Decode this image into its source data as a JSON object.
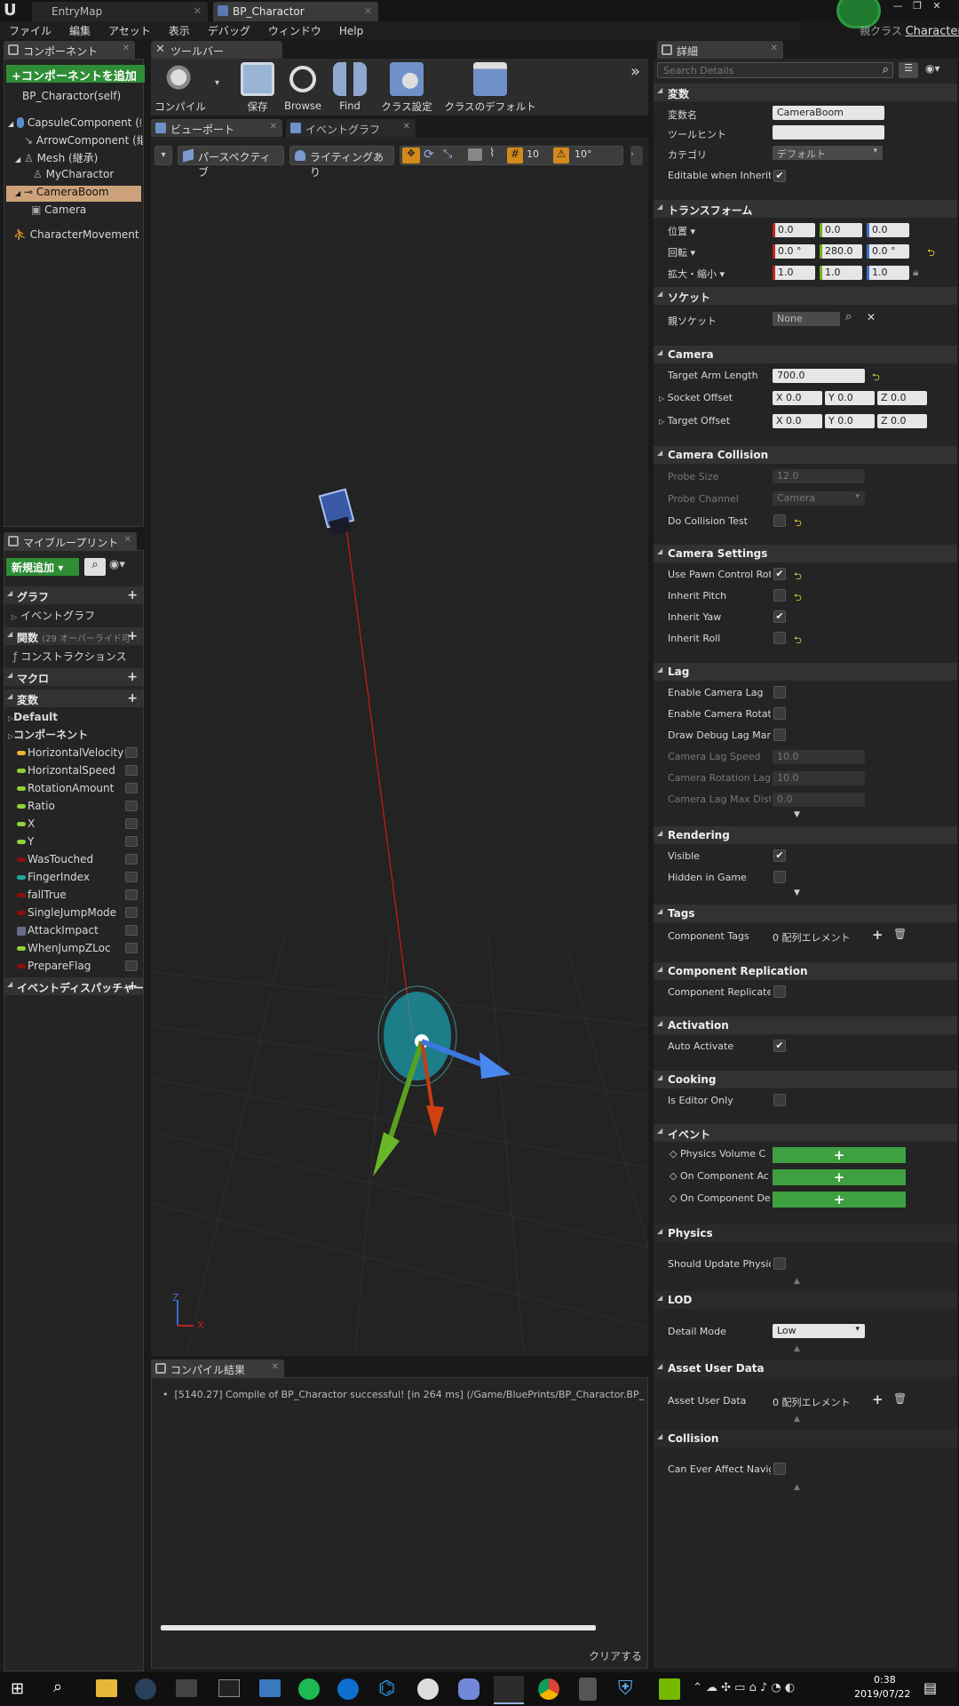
{
  "titlebar": {
    "tabs": [
      {
        "label": "EntryMap",
        "active": false
      },
      {
        "label": "BP_Charactor",
        "active": true
      }
    ],
    "parent_class_label": "親クラス",
    "parent_class_value": "Character"
  },
  "menu": [
    "ファイル",
    "編集",
    "アセット",
    "表示",
    "デバッグ",
    "ウィンドウ",
    "Help"
  ],
  "components_panel": {
    "tab_label": "コンポーネント",
    "add_button": "+コンポーネントを追加",
    "self_label": "BP_Charactor(self)",
    "items": [
      {
        "label": "CapsuleComponent (継",
        "depth": 0
      },
      {
        "label": "ArrowComponent (継",
        "depth": 1
      },
      {
        "label": "Mesh (継承)",
        "depth": 1
      },
      {
        "label": "MyCharactor",
        "depth": 2
      },
      {
        "label": "CameraBoom",
        "depth": 1,
        "selected": true
      },
      {
        "label": "Camera",
        "depth": 2
      },
      {
        "label": "CharacterMovement (継",
        "depth": 0
      }
    ]
  },
  "my_blueprint": {
    "tab_label": "マイブループリント",
    "add_new": "新規追加",
    "graph_header": "グラフ",
    "event_graph": "イベントグラフ",
    "functions_header": "関数",
    "functions_override": "(29 オーバーライド可",
    "construction_script": "コンストラクションス",
    "macros_header": "マクロ",
    "variables_header": "変数",
    "default_category": "Default",
    "components_category": "コンポーネント",
    "variables": [
      {
        "name": "HorizontalVelocity",
        "color": "#e8b63a"
      },
      {
        "name": "HorizontalSpeed",
        "color": "#8ed23a"
      },
      {
        "name": "RotationAmount",
        "color": "#8ed23a"
      },
      {
        "name": "Ratio",
        "color": "#8ed23a"
      },
      {
        "name": "X",
        "color": "#8ed23a"
      },
      {
        "name": "Y",
        "color": "#8ed23a"
      },
      {
        "name": "WasTouched",
        "color": "#8a1010"
      },
      {
        "name": "FingerIndex",
        "color": "#1aa89a"
      },
      {
        "name": "fallTrue",
        "color": "#8a1010"
      },
      {
        "name": "SingleJumpMode",
        "color": "#8a1010"
      },
      {
        "name": "AttackImpact",
        "color": "#6a6a8a"
      },
      {
        "name": "WhenJumpZLoc",
        "color": "#8ed23a"
      },
      {
        "name": "PrepareFlag",
        "color": "#8a1010"
      }
    ],
    "event_dispatchers": "イベントディスパッチャー"
  },
  "toolbar": {
    "tab_label": "ツールバー",
    "buttons": [
      "コンパイル",
      "保存",
      "Browse",
      "Find",
      "クラス設定",
      "クラスのデフォルト"
    ]
  },
  "viewport": {
    "tabs": [
      "ビューポート",
      "イベントグラフ"
    ],
    "perspective": "パースペクティブ",
    "lighting": "ライティングあり",
    "grid_snap": "10",
    "rotation_snap": "10°",
    "axis_x": "X",
    "axis_z": "Z"
  },
  "compiler": {
    "tab_label": "コンパイル結果",
    "message": "[5140.27] Compile of BP_Charactor successful! [in 264 ms] (/Game/BluePrints/BP_Charactor.BP_",
    "clear_button": "クリアする"
  },
  "details": {
    "tab_label": "詳細",
    "search_placeholder": "Search Details",
    "variable": {
      "header": "変数",
      "name_label": "変数名",
      "name_value": "CameraBoom",
      "tooltip_label": "ツールヒント",
      "tooltip_value": "",
      "category_label": "カテゴリ",
      "category_value": "デフォルト",
      "editable_label": "Editable when Inheritec"
    },
    "transform": {
      "header": "トランスフォーム",
      "location_label": "位置",
      "location": [
        "0.0",
        "0.0",
        "0.0"
      ],
      "rotation_label": "回転",
      "rotation": [
        "0.0 °",
        "280.0",
        "0.0 °"
      ],
      "scale_label": "拡大・縮小",
      "scale": [
        "1.0",
        "1.0",
        "1.0"
      ]
    },
    "socket": {
      "header": "ソケット",
      "parent_socket_label": "親ソケット",
      "parent_socket_value": "None"
    },
    "camera": {
      "header": "Camera",
      "target_arm_length_label": "Target Arm Length",
      "target_arm_length": "700.0",
      "socket_offset_label": "Socket Offset",
      "socket_offset": [
        "X  0.0",
        "Y  0.0",
        "Z  0.0"
      ],
      "target_offset_label": "Target Offset",
      "target_offset": [
        "X  0.0",
        "Y  0.0",
        "Z  0.0"
      ]
    },
    "camera_collision": {
      "header": "Camera Collision",
      "probe_size_label": "Probe Size",
      "probe_size": "12.0",
      "probe_channel_label": "Probe Channel",
      "probe_channel": "Camera",
      "do_collision_label": "Do Collision Test"
    },
    "camera_settings": {
      "header": "Camera Settings",
      "rows": [
        {
          "label": "Use Pawn Control Rota",
          "checked": true,
          "reset": true
        },
        {
          "label": "Inherit Pitch",
          "checked": false,
          "reset": true
        },
        {
          "label": "Inherit Yaw",
          "checked": true,
          "reset": false
        },
        {
          "label": "Inherit Roll",
          "checked": false,
          "reset": true
        }
      ]
    },
    "lag": {
      "header": "Lag",
      "enable_camera_lag": "Enable Camera Lag",
      "enable_rotation_lag": "Enable Camera Rotatio",
      "draw_debug": "Draw Debug Lag Marke",
      "lag_speed_label": "Camera Lag Speed",
      "lag_speed": "10.0",
      "rotation_lag_label": "Camera Rotation Lag S",
      "rotation_lag": "10.0",
      "max_distance_label": "Camera Lag Max Dista",
      "max_distance": "0.0"
    },
    "rendering": {
      "header": "Rendering",
      "visible": "Visible",
      "hidden_in_game": "Hidden in Game"
    },
    "tags": {
      "header": "Tags",
      "component_tags": "Component Tags",
      "array_value": "0 配列エレメント"
    },
    "replication": {
      "header": "Component Replication",
      "replicates": "Component Replicates"
    },
    "activation": {
      "header": "Activation",
      "auto_activate": "Auto Activate"
    },
    "cooking": {
      "header": "Cooking",
      "editor_only": "Is Editor Only"
    },
    "events": {
      "header": "イベント",
      "rows": [
        "Physics Volume C",
        "On Component Ac",
        "On Component De"
      ]
    },
    "physics": {
      "header": "Physics",
      "should_update": "Should Update Physics"
    },
    "lod": {
      "header": "LOD",
      "detail_mode_label": "Detail Mode",
      "detail_mode": "Low"
    },
    "asset_user_data": {
      "header": "Asset User Data",
      "label": "Asset User Data",
      "value": "0 配列エレメント"
    },
    "collision": {
      "header": "Collision",
      "label": "Can Ever Affect Naviga"
    }
  },
  "taskbar": {
    "time": "0:38",
    "date": "2019/07/22"
  }
}
